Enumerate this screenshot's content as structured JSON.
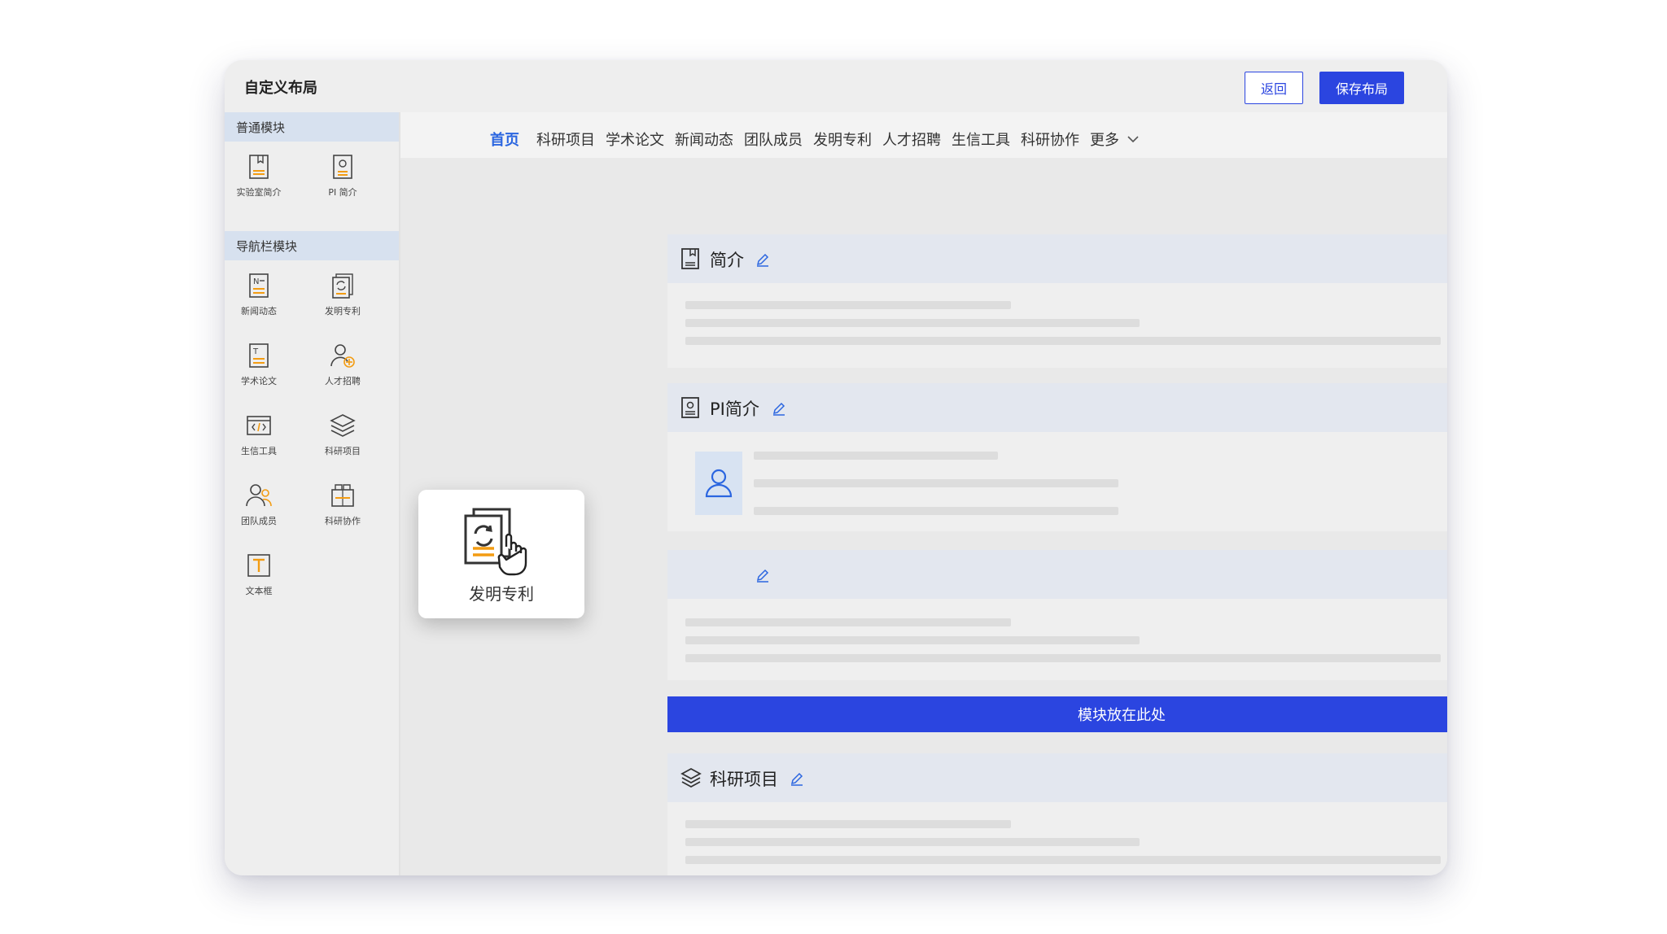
{
  "window": {
    "title": "自定义布局"
  },
  "header": {
    "back_label": "返回",
    "save_label": "保存布局"
  },
  "sidebar": {
    "sections": [
      {
        "title": "普通模块",
        "items": [
          {
            "label": "实验室简介",
            "icon": "lab-intro-icon"
          },
          {
            "label": "PI 简介",
            "icon": "pi-intro-icon"
          }
        ]
      },
      {
        "title": "导航栏模块",
        "items": [
          {
            "label": "新闻动态",
            "icon": "news-icon"
          },
          {
            "label": "发明专利",
            "icon": "patent-icon"
          },
          {
            "label": "学术论文",
            "icon": "paper-icon"
          },
          {
            "label": "人才招聘",
            "icon": "recruit-icon"
          },
          {
            "label": "生信工具",
            "icon": "bioinfo-tool-icon"
          },
          {
            "label": "科研项目",
            "icon": "research-project-icon"
          },
          {
            "label": "团队成员",
            "icon": "team-icon"
          },
          {
            "label": "科研协作",
            "icon": "collaboration-icon"
          },
          {
            "label": "文本框",
            "icon": "textbox-icon"
          }
        ]
      }
    ]
  },
  "nav": {
    "tabs": [
      "首页",
      "科研项目",
      "学术论文",
      "新闻动态",
      "团队成员",
      "发明专利",
      "人才招聘",
      "生信工具",
      "科研协作"
    ],
    "more_label": "更多",
    "active": "首页"
  },
  "cards": [
    {
      "title": "简介",
      "icon": "document-icon"
    },
    {
      "title": "PI简介",
      "icon": "profile-icon"
    },
    {
      "title": "",
      "icon": ""
    },
    {
      "title": "科研项目",
      "icon": "layers-icon"
    }
  ],
  "dropzone": {
    "label": "模块放在此处"
  },
  "drag": {
    "label": "发明专利",
    "icon": "patent-icon"
  },
  "colors": {
    "primary": "#2b45e0",
    "accent": "#f39c12",
    "active_tab": "#2b66e0",
    "header_bg": "#d7e1ef"
  }
}
